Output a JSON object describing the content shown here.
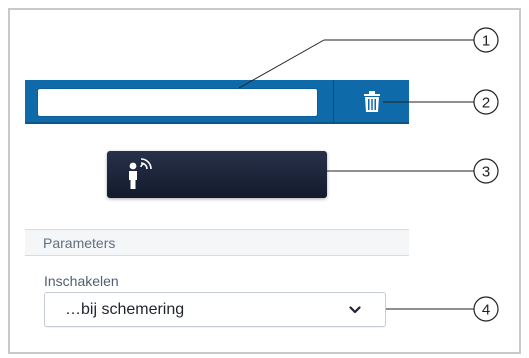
{
  "toolbar": {
    "name_value": "",
    "delete_icon": "trash-icon"
  },
  "device_button": {
    "icon": "person-remote-icon"
  },
  "parameters": {
    "title": "Parameters"
  },
  "switch_on": {
    "label": "Inschakelen",
    "selected_value": "…bij schemering",
    "icon": "chevron-down-icon"
  },
  "callouts": [
    {
      "number": "1"
    },
    {
      "number": "2"
    },
    {
      "number": "3"
    },
    {
      "number": "4"
    }
  ],
  "colors": {
    "bar_blue": "#0f6aa9",
    "dark_button": "#1a2238",
    "frame_border": "#c9c9c9"
  }
}
